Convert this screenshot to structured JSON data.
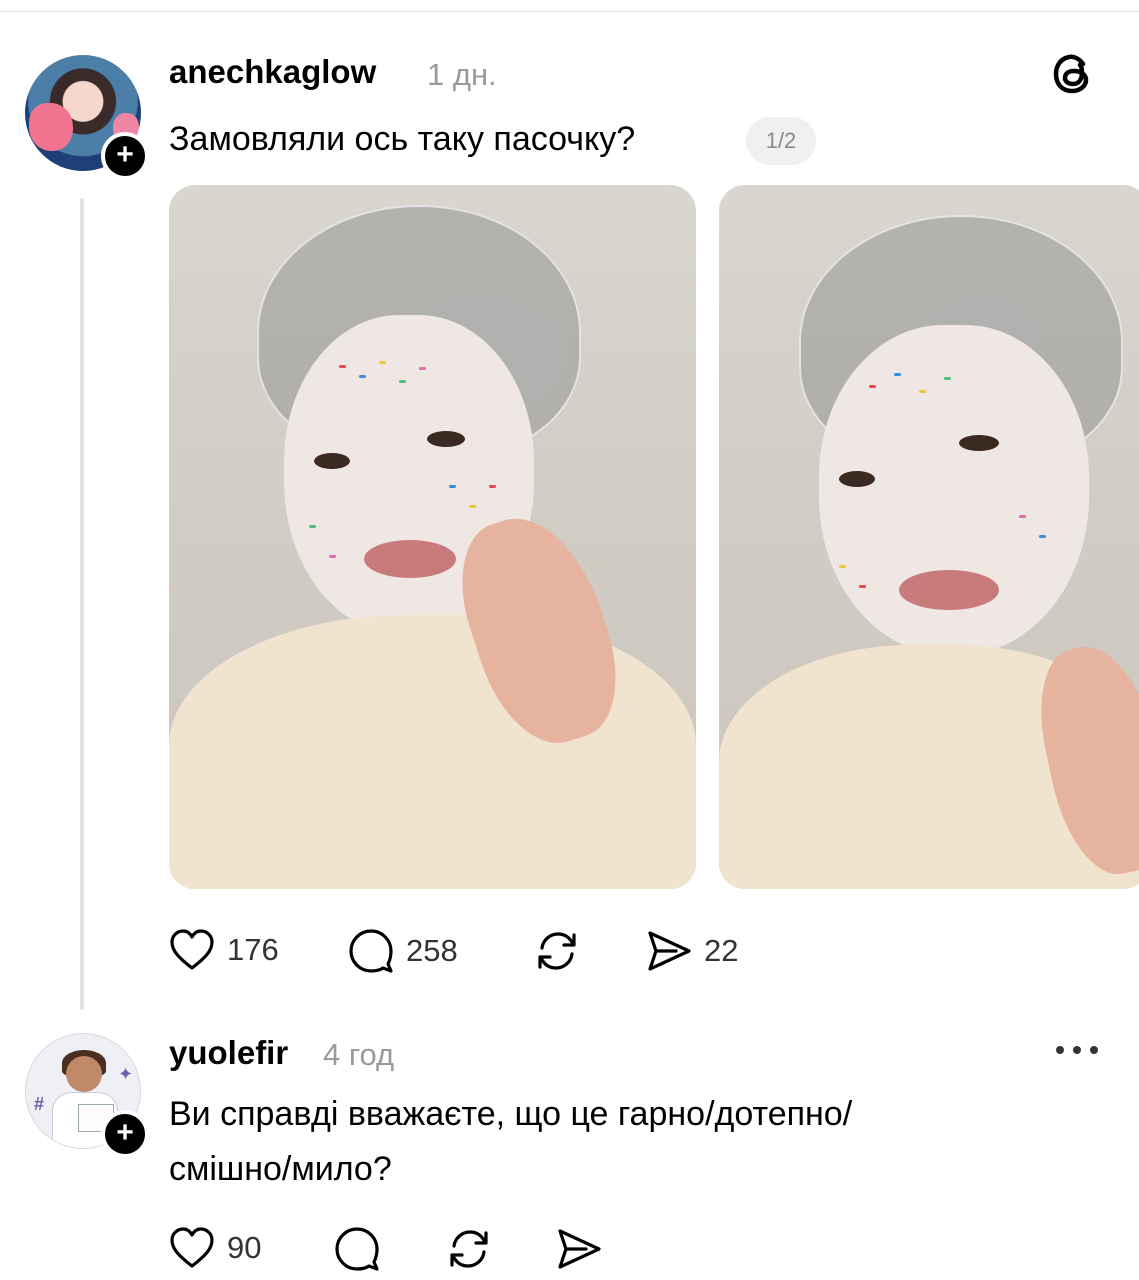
{
  "post": {
    "username": "anechkaglow",
    "time": "1 дн.",
    "text": "Замовляли ось таку пасочку?",
    "pager": "1/2",
    "likes": "176",
    "replies": "258",
    "shares": "22"
  },
  "reply": {
    "username": "yuolefir",
    "time": "4 год",
    "text_line1": "Ви справді вважаєте, що це гарно/дотепно/",
    "text_line2": "смішно/мило?",
    "likes": "90"
  },
  "icons": {
    "brand": "threads-icon",
    "follow": "plus-icon",
    "like": "heart-icon",
    "reply": "comment-icon",
    "repost": "repost-icon",
    "share": "send-icon",
    "more": "more-icon"
  }
}
